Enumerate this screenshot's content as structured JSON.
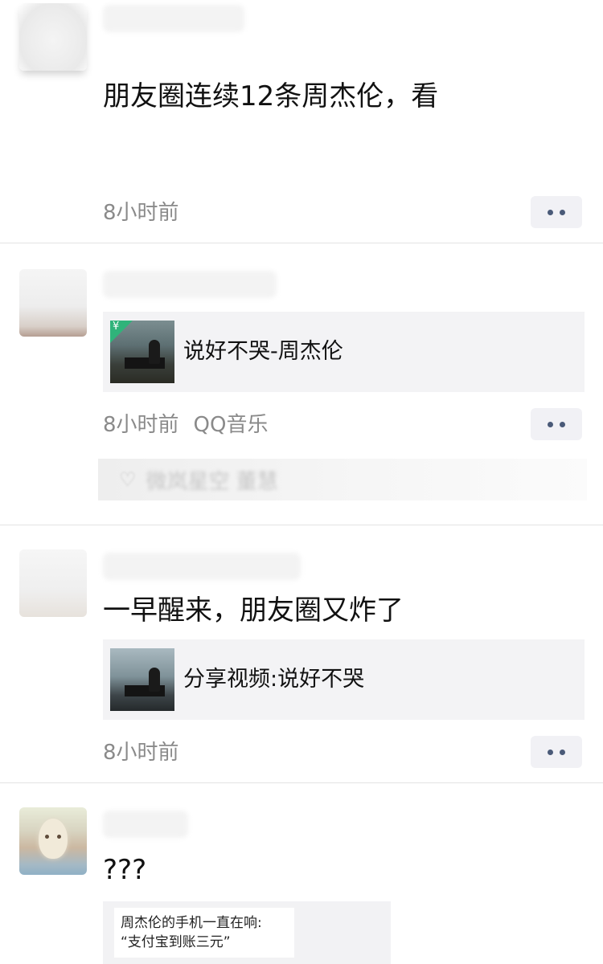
{
  "posts": [
    {
      "text": "朋友圈连续12条周杰伦，看",
      "time": "8小时前"
    },
    {
      "card_title": "说好不哭-周杰伦",
      "card_badge": "¥",
      "time": "8小时前",
      "source": "QQ音乐",
      "likes": "微岚星空 董慧"
    },
    {
      "text": "一早醒来，朋友圈又炸了",
      "card_title": "分享视频:说好不哭",
      "time": "8小时前"
    },
    {
      "text": "???",
      "quote_line1": "周杰伦的手机一直在响:",
      "quote_line2": "“支付宝到账三元”"
    }
  ],
  "icons": {
    "more": "more-dots-icon",
    "like": "heart-icon"
  },
  "colors": {
    "link_blue": "#4a5a78",
    "meta_gray": "#8a8a8a",
    "card_bg": "#f3f3f5",
    "badge_green": "#2fb37a"
  }
}
